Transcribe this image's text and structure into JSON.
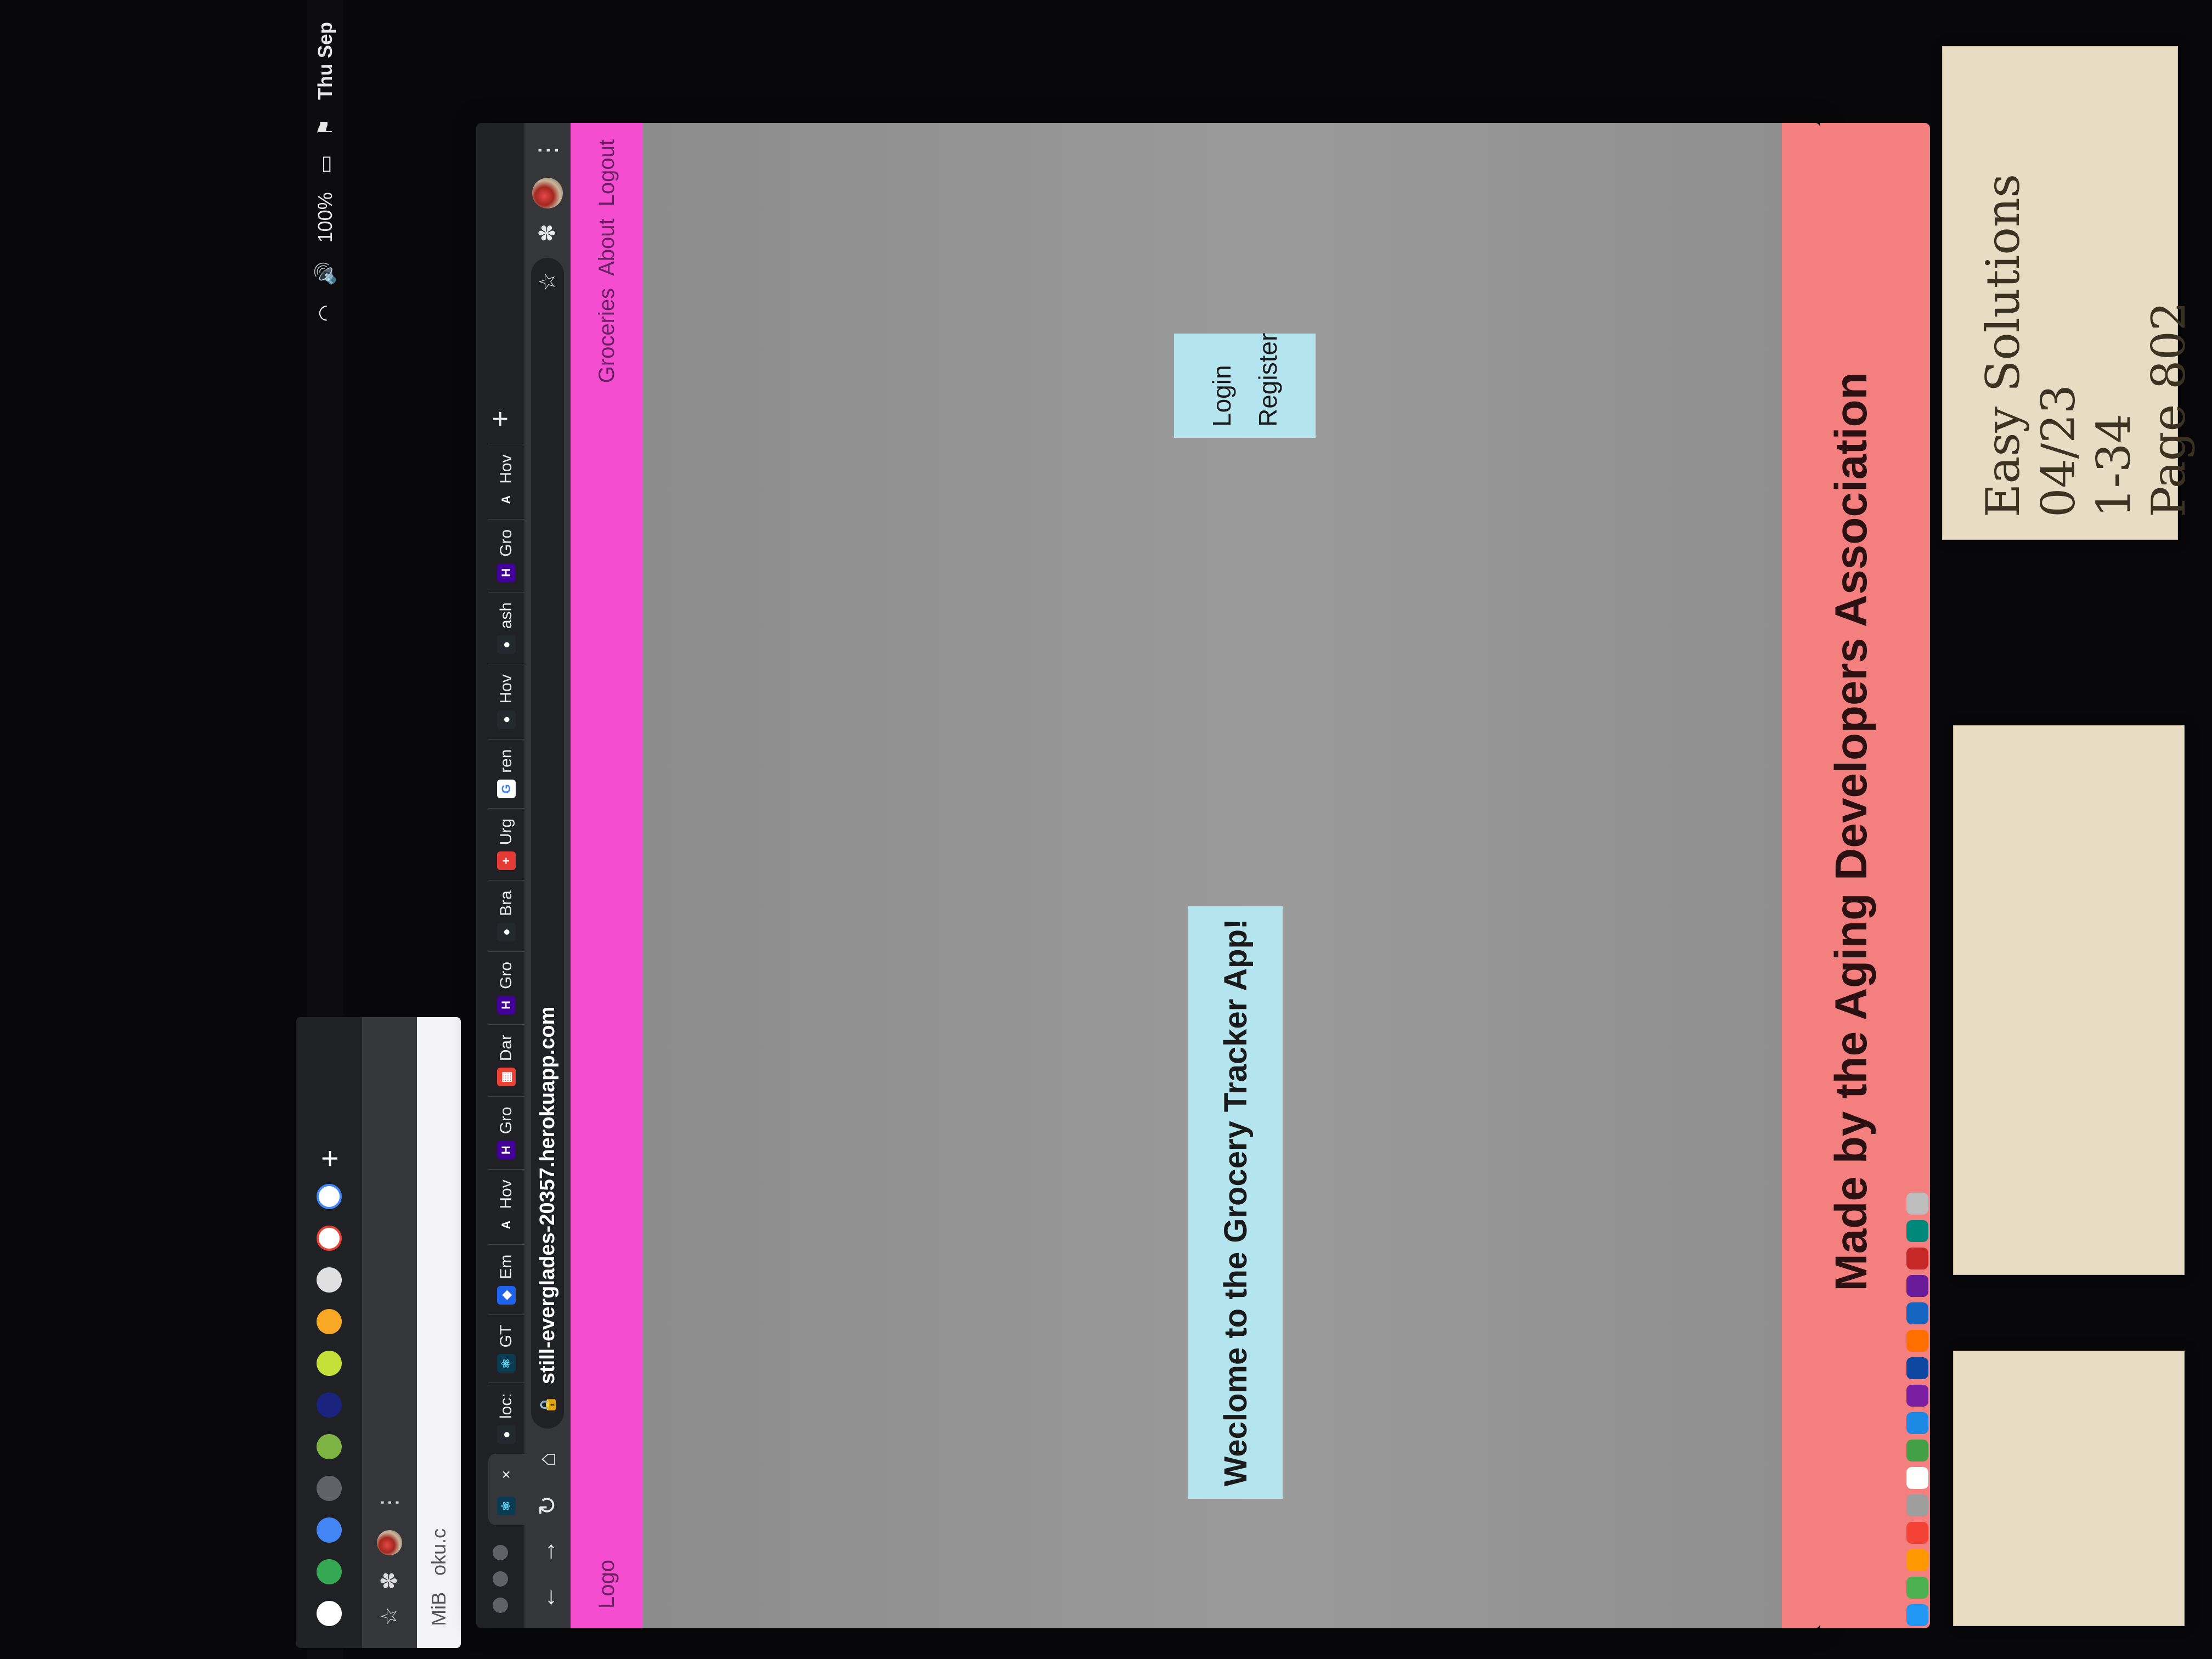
{
  "menubar": {
    "date": "Thu Sep",
    "battery": "100%"
  },
  "background_window": {
    "page_text_1": "MiB",
    "page_text_2": "oku.c"
  },
  "browser": {
    "tabs": [
      {
        "label": "",
        "icon": "react-icon",
        "active": true,
        "close": "×"
      },
      {
        "label": "loc:",
        "icon": "github-icon"
      },
      {
        "label": "GT",
        "icon": "react-icon"
      },
      {
        "label": "Em",
        "icon": "docker-icon"
      },
      {
        "label": "Hov",
        "icon": "a-icon"
      },
      {
        "label": "Gro",
        "icon": "heroku-icon"
      },
      {
        "label": "Dar",
        "icon": "calendar-icon"
      },
      {
        "label": "Gro",
        "icon": "heroku-icon"
      },
      {
        "label": "Bra",
        "icon": "github-icon"
      },
      {
        "label": "Urg",
        "icon": "red-cross-icon"
      },
      {
        "label": "ren",
        "icon": "google-icon"
      },
      {
        "label": "Hov",
        "icon": "github-icon"
      },
      {
        "label": "ash",
        "icon": "github-icon"
      },
      {
        "label": "Gro",
        "icon": "heroku-icon"
      },
      {
        "label": "Hov",
        "icon": "a-icon"
      }
    ],
    "newtab": "+",
    "toolbar": {
      "back": "←",
      "forward": "→",
      "reload": "↻",
      "home": "⌂",
      "lock": "🔒",
      "url": "still-everglades-20357.herokuapp.com",
      "star": "☆",
      "extensions": "✽",
      "menu": "⋮"
    }
  },
  "site": {
    "logo": "Logo",
    "nav": [
      "Groceries",
      "About",
      "Logout"
    ],
    "welcome": "Weclome to the Grocery Tracker App!",
    "auth": [
      "Login",
      "Register"
    ],
    "footer": "Made by the Aging Developers Association"
  },
  "desk": {
    "note_lines": [
      "Easy Solutions 04/23",
      "1-34",
      "Page 802"
    ]
  },
  "colors": {
    "navbar": "#f44dd0",
    "content_bg": "#8f8f8f",
    "welcome_bg": "#b4e4ee",
    "footer": "#f37f7f"
  }
}
